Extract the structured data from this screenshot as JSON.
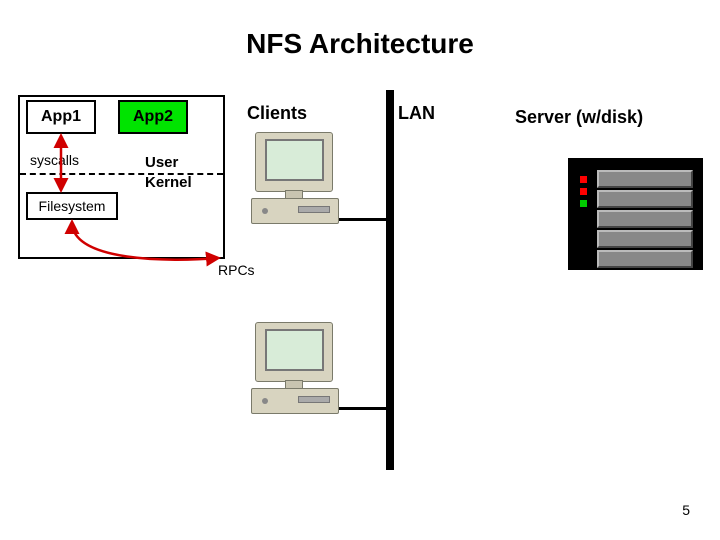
{
  "title": "NFS Architecture",
  "page_number": "5",
  "stack": {
    "app1": "App1",
    "app2": "App2",
    "syscalls": "syscalls",
    "filesystem": "Filesystem",
    "user": "User",
    "kernel": "Kernel"
  },
  "labels": {
    "clients": "Clients",
    "lan": "LAN",
    "server": "Server (w/disk)",
    "rpcs": "RPCs"
  }
}
